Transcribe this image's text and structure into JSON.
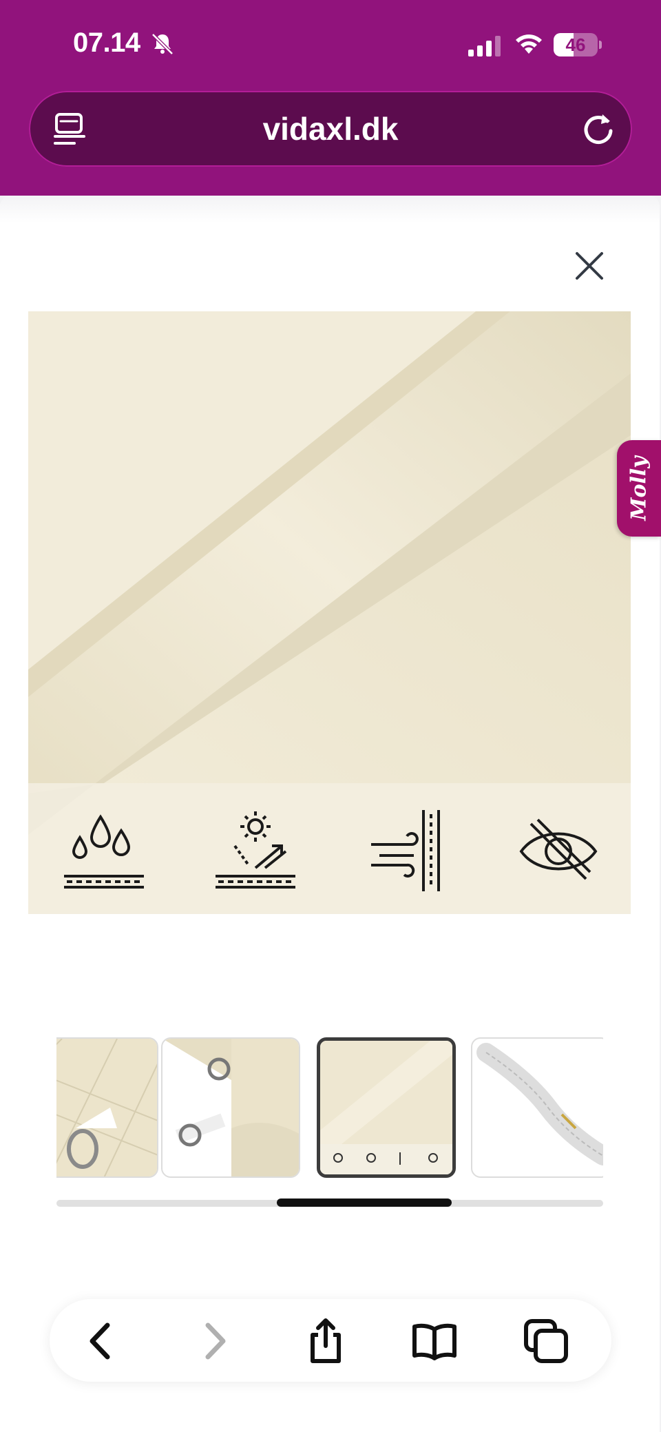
{
  "status_bar": {
    "time": "07.14",
    "battery_level": "46",
    "battery_fraction": 0.46,
    "icons": [
      "bell-slash-icon",
      "cellular-signal-icon",
      "wifi-icon",
      "battery-icon"
    ]
  },
  "browser": {
    "url": "vidaxl.dk",
    "left_icon": "tabs-list-icon",
    "right_icon": "reload-icon"
  },
  "gallery": {
    "close_icon": "close-icon",
    "main_image": "beige shade sail fabric close-up",
    "feature_icons": [
      "waterproof-icon",
      "uv-protection-icon",
      "windproof-icon",
      "privacy-icon"
    ],
    "thumbnails": [
      {
        "name": "thumb-corner-ring",
        "active": false
      },
      {
        "name": "thumb-rings-detail",
        "active": false
      },
      {
        "name": "thumb-fabric-features",
        "active": true
      },
      {
        "name": "thumb-rope",
        "active": false
      }
    ]
  },
  "chat_widget": {
    "label": "Molly"
  },
  "toolbar": {
    "icons": [
      "back-icon",
      "forward-icon",
      "share-icon",
      "bookmarks-icon",
      "tabs-icon"
    ]
  },
  "colors": {
    "brand": "#91137c",
    "url_bar": "#5c0c4e",
    "fabric": "#efe8d2",
    "molly": "#a1106b"
  }
}
